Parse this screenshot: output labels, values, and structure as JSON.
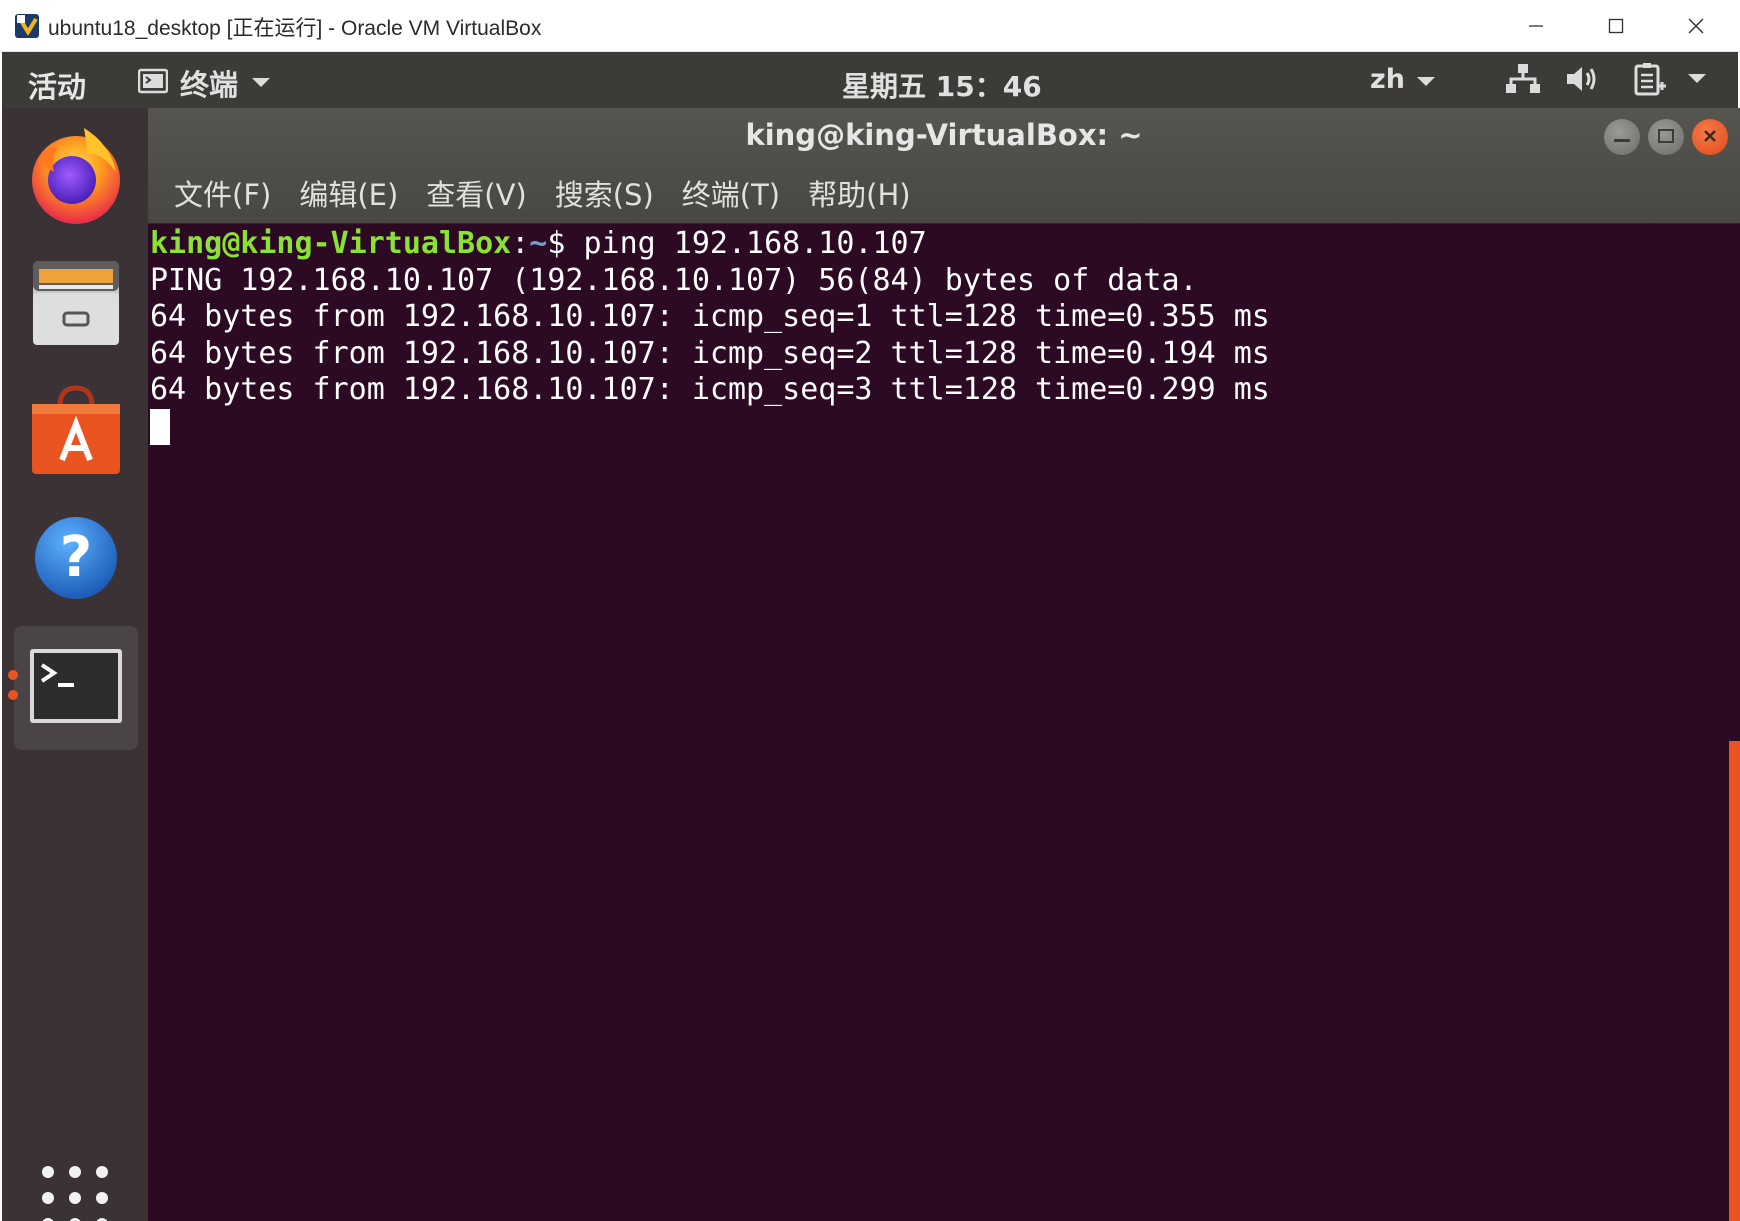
{
  "host_window": {
    "title": "ubuntu18_desktop [正在运行] - Oracle VM VirtualBox",
    "icon": "virtualbox-icon",
    "controls": [
      "minimize-icon",
      "maximize-icon",
      "close-icon"
    ]
  },
  "topbar": {
    "activities": "活动",
    "app_label": "终端",
    "clock": "星期五 15：46",
    "input_lang": "zh",
    "tray_icons": [
      "network-icon",
      "volume-icon",
      "power-icon",
      "chevron-down-icon"
    ]
  },
  "dock": {
    "items": [
      {
        "name": "firefox",
        "icon": "firefox-icon"
      },
      {
        "name": "files",
        "icon": "file-cabinet-icon"
      },
      {
        "name": "software",
        "icon": "software-center-icon"
      },
      {
        "name": "help",
        "icon": "help-icon"
      },
      {
        "name": "terminal",
        "icon": "terminal-icon",
        "active": true
      }
    ],
    "apps_grid_icon": "app-grid-icon"
  },
  "terminal": {
    "title": "king@king-VirtualBox: ~",
    "menu": [
      "文件(F)",
      "编辑(E)",
      "查看(V)",
      "搜索(S)",
      "终端(T)",
      "帮助(H)"
    ],
    "prompt_user": "king@king-VirtualBox",
    "prompt_sep": ":",
    "prompt_path": "~",
    "prompt_symbol": "$ ",
    "command": "ping 192.168.10.107",
    "output": [
      "PING 192.168.10.107 (192.168.10.107) 56(84) bytes of data.",
      "64 bytes from 192.168.10.107: icmp_seq=1 ttl=128 time=0.355 ms",
      "64 bytes from 192.168.10.107: icmp_seq=2 ttl=128 time=0.194 ms",
      "64 bytes from 192.168.10.107: icmp_seq=3 ttl=128 time=0.299 ms"
    ]
  },
  "colors": {
    "terminal_bg": "#2c0a24",
    "prompt_user": "#8ae234",
    "prompt_path": "#729fcf",
    "ubuntu_orange": "#e95420"
  }
}
